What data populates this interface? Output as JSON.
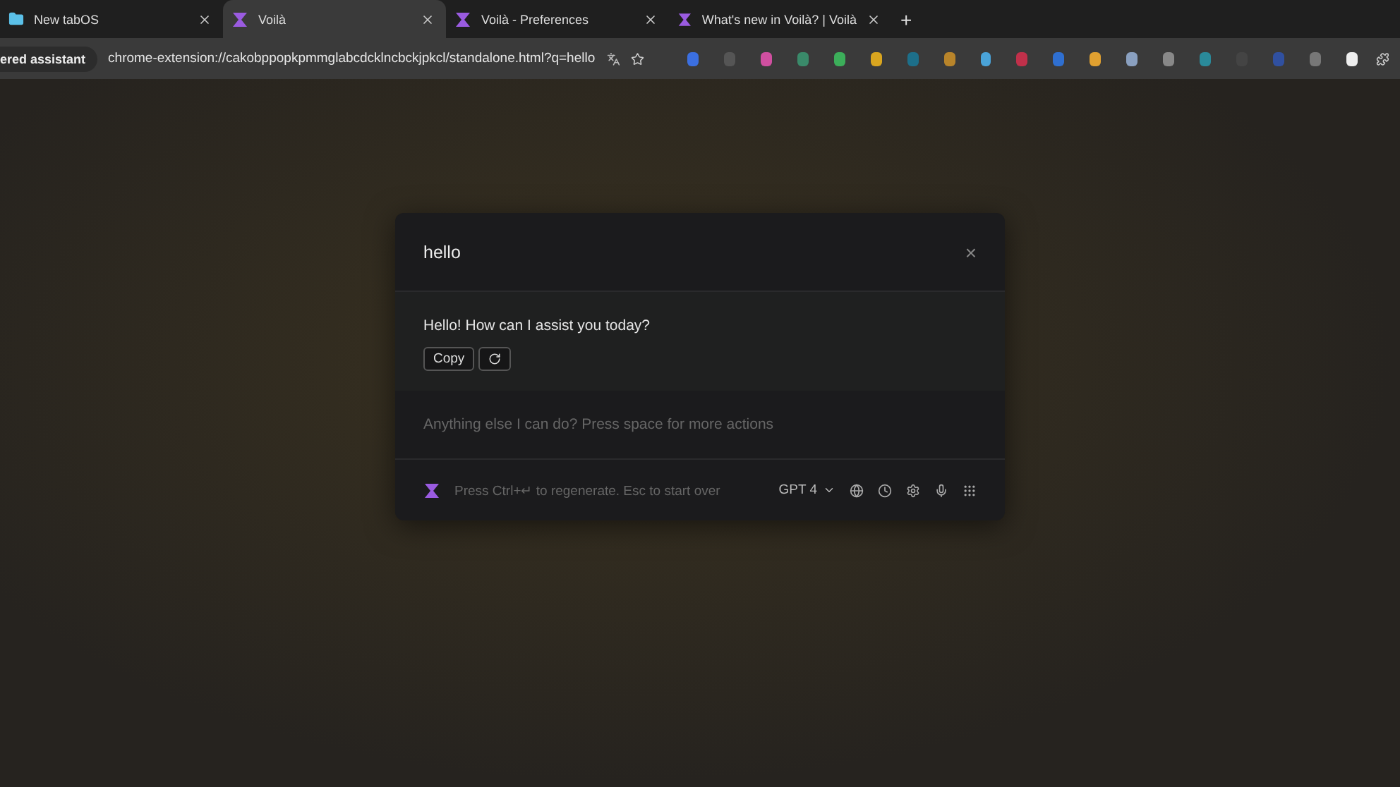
{
  "tabs": [
    {
      "title": "New tabOS",
      "kind": "folder",
      "selected": false
    },
    {
      "title": "Voilà",
      "kind": "voila",
      "selected": true
    },
    {
      "title": "Voilà - Preferences",
      "kind": "voila",
      "selected": false
    },
    {
      "title": "What's new in Voilà? | Voilà",
      "kind": "voila",
      "selected": false
    }
  ],
  "new_tab": "+",
  "address_bar": {
    "chip": "ered assistant",
    "url": "chrome-extension://cakobppopkpmmglabcdcklncbckjpkcl/standalone.html?q=hello"
  },
  "dialog": {
    "query": "hello",
    "close": "×",
    "answer": "Hello! How can I assist you today?",
    "copy_button": "Copy",
    "input": {
      "placeholder": "Anything else I can do? Press space for more actions"
    },
    "hint": "Press Ctrl+↵ to regenerate. Esc to start over",
    "model": "GPT 4"
  }
}
